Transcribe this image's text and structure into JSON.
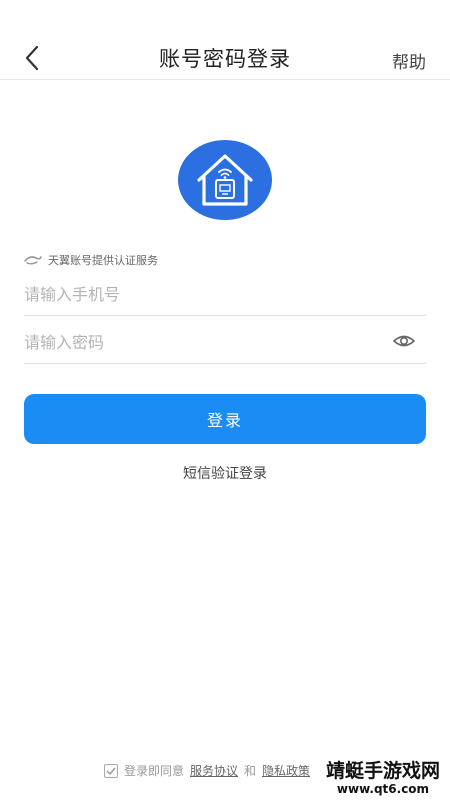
{
  "header": {
    "title": "账号密码登录",
    "help_label": "帮助",
    "back_icon": "chevron-left-icon"
  },
  "logo": {
    "icon": "smart-home-wifi-icon",
    "color": "#2b6fe0"
  },
  "provider": {
    "icon": "tianyi-logo-icon",
    "text": "天翼账号提供认证服务"
  },
  "phone": {
    "placeholder": "请输入手机号",
    "value": ""
  },
  "password": {
    "placeholder": "请输入密码",
    "value": "",
    "toggle_icon": "eye-icon"
  },
  "login_button": {
    "label": "登录",
    "color": "#1a8cf3"
  },
  "sms_login_label": "短信验证登录",
  "agreement": {
    "prefix": "登录即同意",
    "service_link": "服务协议",
    "and": "和",
    "privacy_link": "隐私政策"
  },
  "watermark": {
    "title": "靖蜓手游戏网",
    "url": "www.qt6.com"
  }
}
